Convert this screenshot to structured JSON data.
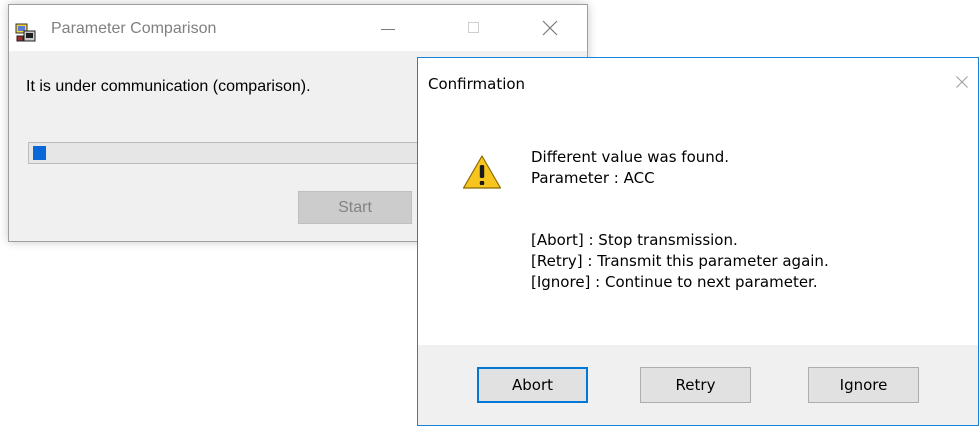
{
  "comparison_window": {
    "title": "Parameter Comparison",
    "status_text": "It is under communication (comparison).",
    "progress": 0.03,
    "start_label": "Start",
    "icons": [
      "app-icon",
      "minimize-icon",
      "maximize-icon",
      "close-icon"
    ]
  },
  "confirmation_dialog": {
    "title": "Confirmation",
    "icon": "warning-icon",
    "message_lines": [
      "Different value was found.",
      "Parameter : ACC",
      "[Abort] : Stop transmission.",
      "[Retry] : Transmit this parameter again.",
      "[Ignore] : Continue to next parameter."
    ],
    "buttons": {
      "abort": "Abort",
      "retry": "Retry",
      "ignore": "Ignore"
    }
  },
  "colors": {
    "dialog_border": "#1883d7",
    "progress_fill": "#0a67d8",
    "default_button_border": "#0078d7",
    "warning_yellow": "#f7c51e"
  }
}
